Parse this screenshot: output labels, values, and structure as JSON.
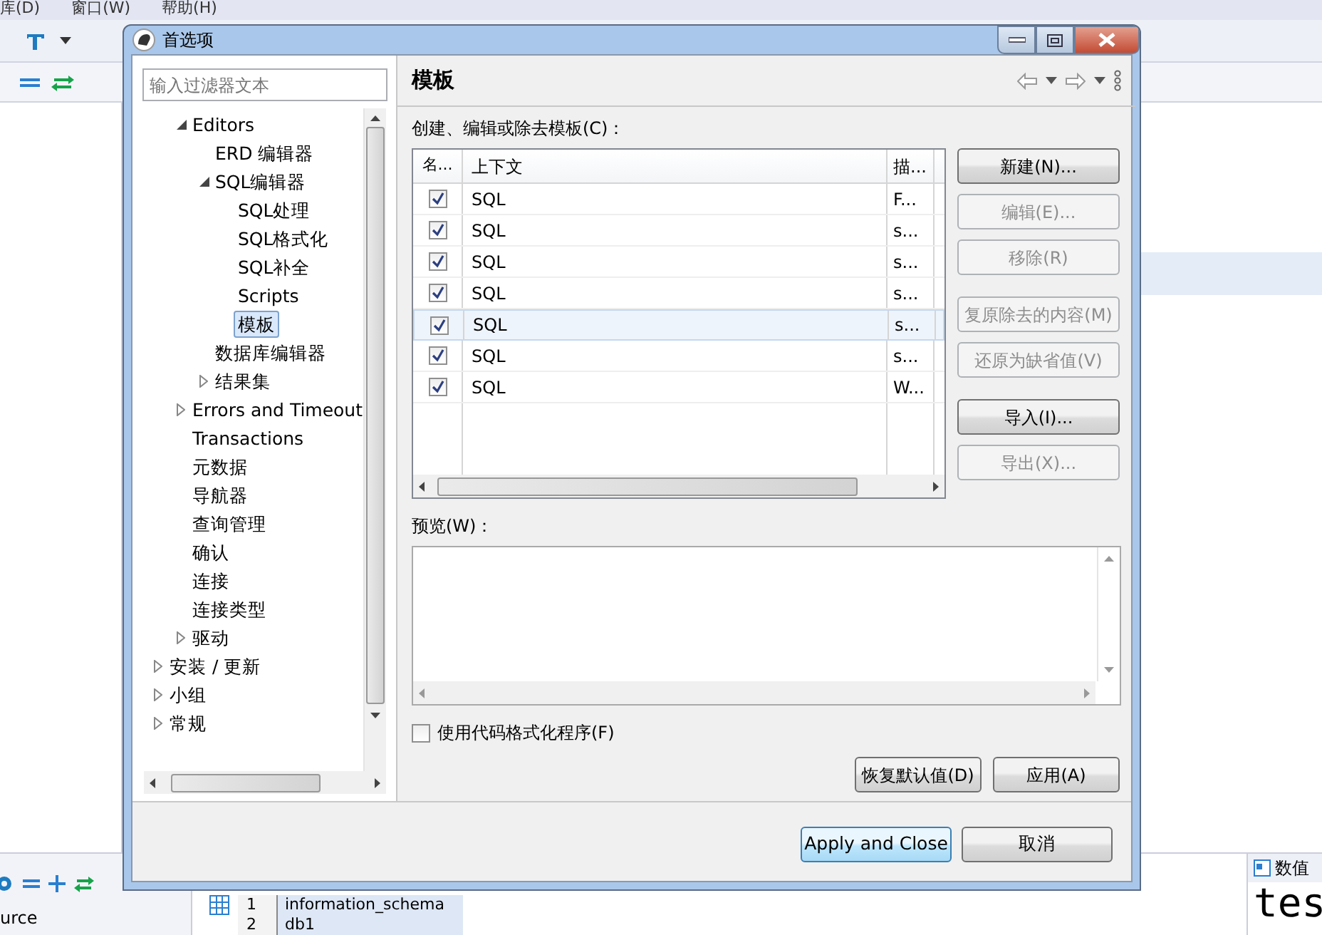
{
  "background_app": {
    "menu": [
      "库(D)",
      "窗口(W)",
      "帮助(H)"
    ],
    "bottom_left_text": "urce",
    "result_rows": [
      {
        "number": "1",
        "value": "information_schema"
      },
      {
        "number": "2",
        "value": "db1"
      }
    ],
    "value_panel": {
      "title": "数值",
      "text": "tes"
    }
  },
  "window": {
    "title": "首选项"
  },
  "filter": {
    "placeholder": "输入过滤器文本"
  },
  "tree": {
    "items": [
      {
        "children": [
          {
            "label": "Editors",
            "expanded": true,
            "selected": false,
            "children": [
              {
                "label": "ERD 编辑器",
                "selected": false
              },
              {
                "label": "SQL编辑器",
                "expanded": true,
                "selected": false,
                "children": [
                  {
                    "label": "SQL处理",
                    "selected": false
                  },
                  {
                    "label": "SQL格式化",
                    "selected": false
                  },
                  {
                    "label": "SQL补全",
                    "selected": false
                  },
                  {
                    "label": "Scripts",
                    "selected": false
                  },
                  {
                    "label": "模板",
                    "selected": true
                  }
                ]
              },
              {
                "label": "数据库编辑器",
                "selected": false
              },
              {
                "label": "结果集",
                "expanded": false,
                "selected": false
              }
            ]
          },
          {
            "label": "Errors and Timeout",
            "expanded": false,
            "selected": false
          },
          {
            "label": "Transactions",
            "selected": false
          },
          {
            "label": "元数据",
            "selected": false
          },
          {
            "label": "导航器",
            "selected": false
          },
          {
            "label": "查询管理",
            "selected": false
          },
          {
            "label": "确认",
            "selected": false
          },
          {
            "label": "连接",
            "selected": false
          },
          {
            "label": "连接类型",
            "selected": false
          },
          {
            "label": "驱动",
            "expanded": false,
            "selected": false
          }
        ]
      },
      {
        "label": "安装 / 更新",
        "expanded": false,
        "selected": false
      },
      {
        "label": "小组",
        "expanded": false,
        "selected": false
      },
      {
        "label": "常规",
        "expanded": false,
        "selected": false
      }
    ]
  },
  "page": {
    "title": "模板",
    "templates_label": "创建、编辑或除去模板(C)：",
    "table": {
      "columns": [
        "名...",
        "上下文",
        "描..."
      ],
      "rows": [
        {
          "checked": true,
          "context": "SQL",
          "description": "F...",
          "selected": false
        },
        {
          "checked": true,
          "context": "SQL",
          "description": "s...",
          "selected": false
        },
        {
          "checked": true,
          "context": "SQL",
          "description": "s...",
          "selected": false
        },
        {
          "checked": true,
          "context": "SQL",
          "description": "s...",
          "selected": false
        },
        {
          "checked": true,
          "context": "SQL",
          "description": "s...",
          "selected": true
        },
        {
          "checked": true,
          "context": "SQL",
          "description": "s...",
          "selected": false
        },
        {
          "checked": true,
          "context": "SQL",
          "description": "W...",
          "selected": false
        }
      ]
    },
    "button_groups": [
      [
        {
          "label": "新建(N)...",
          "disabled": false
        },
        {
          "label": "编辑(E)...",
          "disabled": true
        },
        {
          "label": "移除(R)",
          "disabled": true
        }
      ],
      [
        {
          "label": "复原除去的内容(M)",
          "disabled": true
        },
        {
          "label": "还原为缺省值(V)",
          "disabled": true
        }
      ],
      [
        {
          "label": "导入(I)...",
          "disabled": false
        },
        {
          "label": "导出(X)...",
          "disabled": true
        }
      ]
    ],
    "preview_label": "预览(W)：",
    "formatter_checkbox": {
      "label": "使用代码格式化程序(F)",
      "checked": false
    },
    "page_buttons": [
      "恢复默认值(D)",
      "应用(A)"
    ]
  },
  "footer_buttons": [
    {
      "label": "Apply and Close",
      "default": true
    },
    {
      "label": "取消",
      "default": false
    }
  ]
}
